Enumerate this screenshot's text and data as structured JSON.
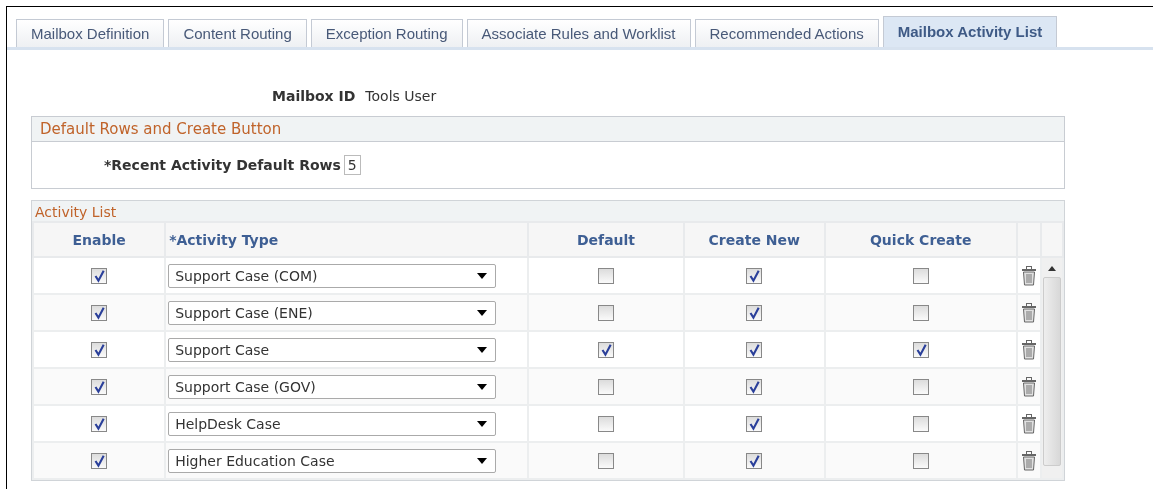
{
  "tabs": [
    {
      "label": "Mailbox Definition",
      "selected": false
    },
    {
      "label": "Content Routing",
      "selected": false
    },
    {
      "label": "Exception Routing",
      "selected": false
    },
    {
      "label": "Associate Rules and Worklist",
      "selected": false
    },
    {
      "label": "Recommended Actions",
      "selected": false
    },
    {
      "label": "Mailbox Activity List",
      "selected": true
    }
  ],
  "mailbox_id": {
    "label": "Mailbox ID",
    "value": "Tools User"
  },
  "default_rows_section": {
    "title": "Default Rows and Create Button",
    "field_label": "*Recent Activity Default Rows",
    "field_value": "5"
  },
  "activity_list": {
    "title": "Activity List",
    "columns": [
      "Enable",
      "*Activity Type",
      "Default",
      "Create New",
      "Quick Create"
    ],
    "rows": [
      {
        "enable": true,
        "activity_type": "Support Case (COM)",
        "default": false,
        "create_new": true,
        "quick_create": false
      },
      {
        "enable": true,
        "activity_type": "Support Case (ENE)",
        "default": false,
        "create_new": true,
        "quick_create": false
      },
      {
        "enable": true,
        "activity_type": "Support Case",
        "default": true,
        "create_new": true,
        "quick_create": true
      },
      {
        "enable": true,
        "activity_type": "Support Case (GOV)",
        "default": false,
        "create_new": true,
        "quick_create": false
      },
      {
        "enable": true,
        "activity_type": "HelpDesk Case",
        "default": false,
        "create_new": true,
        "quick_create": false
      },
      {
        "enable": true,
        "activity_type": "Higher Education Case",
        "default": false,
        "create_new": true,
        "quick_create": false
      }
    ]
  }
}
